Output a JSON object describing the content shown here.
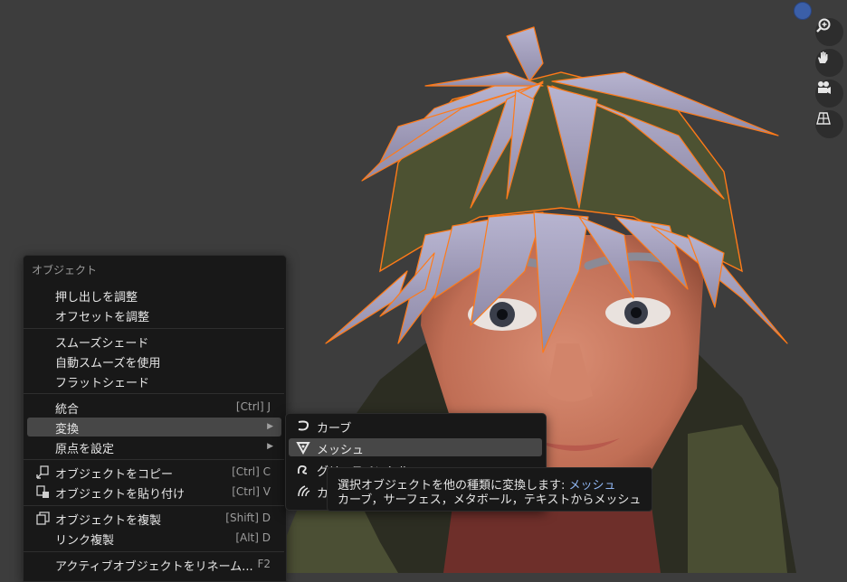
{
  "menu": {
    "title": "オブジェクト",
    "items": [
      {
        "label": "押し出しを調整"
      },
      {
        "label": "オフセットを調整"
      },
      {
        "label": "スムーズシェード"
      },
      {
        "label": "自動スムーズを使用"
      },
      {
        "label": "フラットシェード"
      },
      {
        "label": "統合",
        "shortcut": "[Ctrl] J"
      },
      {
        "label": "変換"
      },
      {
        "label": "原点を設定"
      },
      {
        "label": "オブジェクトをコピー",
        "shortcut": "[Ctrl] C"
      },
      {
        "label": "オブジェクトを貼り付け",
        "shortcut": "[Ctrl] V"
      },
      {
        "label": "オブジェクトを複製",
        "shortcut": "[Shift] D"
      },
      {
        "label": "リンク複製",
        "shortcut": "[Alt] D"
      },
      {
        "label": "アクティブオブジェクトをリネーム...",
        "shortcut": "F2"
      }
    ]
  },
  "submenu": {
    "items": [
      {
        "label": "カーブ"
      },
      {
        "label": "メッシュ"
      },
      {
        "label": "グリースペンシル"
      },
      {
        "label": "カーブ"
      }
    ]
  },
  "tooltip": {
    "line1_prefix": "選択オブジェクトを他の種類に変換します: ",
    "line1_highlight": "メッシュ",
    "line2": "カーブ，サーフェス，メタボール，テキストからメッシュ"
  },
  "icons": {
    "zoom": "zoom-in-icon",
    "hand": "hand-icon",
    "camera": "camera-icon",
    "grid": "perspective-grid-icon"
  },
  "colors": {
    "viewport_bg": "#3d3d3d",
    "menu_bg": "#181818",
    "highlight": "#474747",
    "selection_outline": "#ff7a18",
    "tooltip_highlight": "#8fb5f0"
  }
}
